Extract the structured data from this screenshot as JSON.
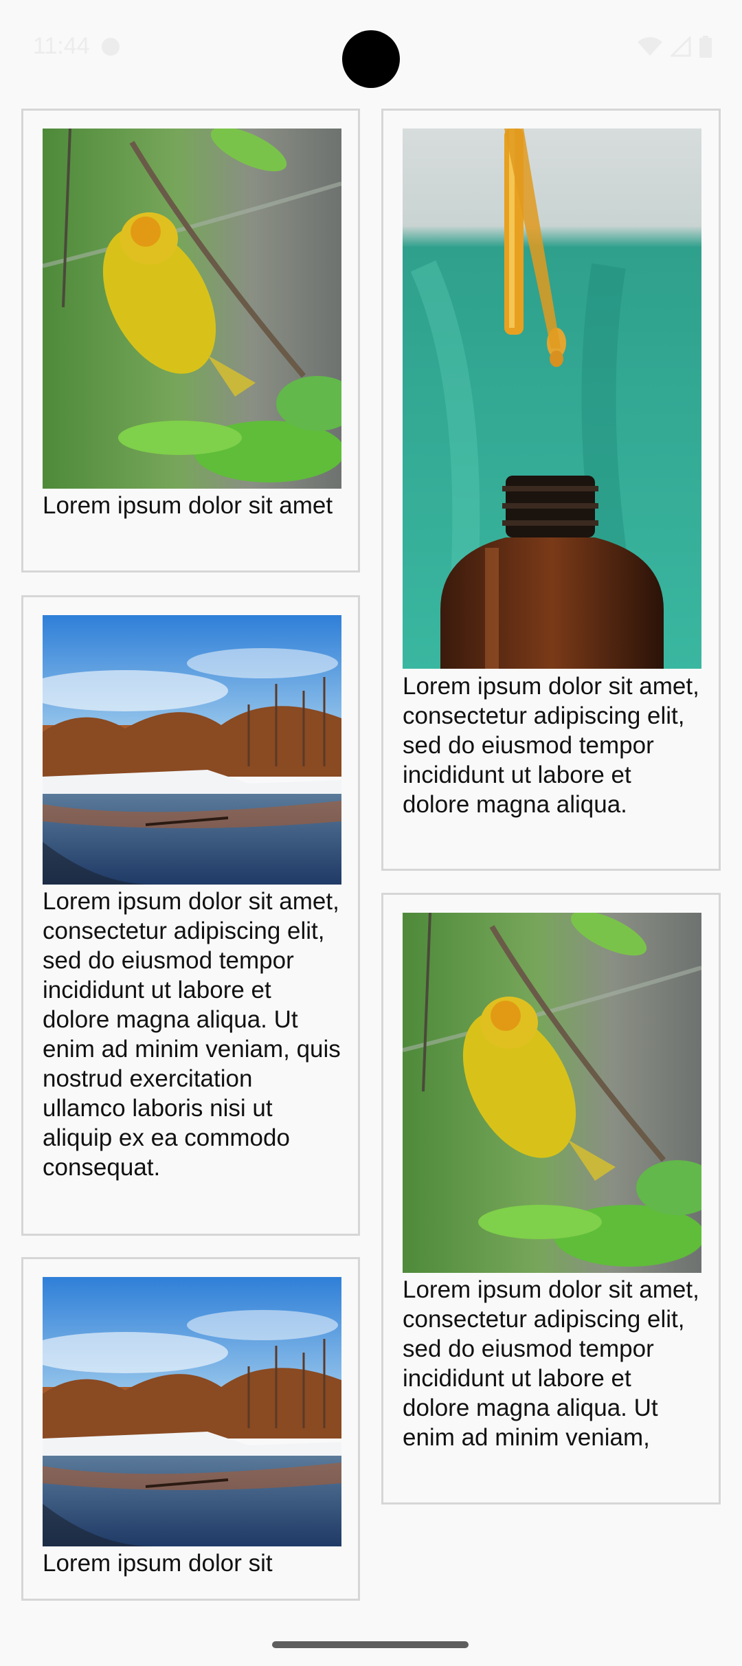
{
  "status_bar": {
    "time": "11:44",
    "icons": [
      "settings-icon",
      "wifi-icon",
      "signal-icon",
      "battery-icon"
    ]
  },
  "cards": [
    {
      "image": "yellow-bird-on-branch",
      "caption": "Lorem ipsum dolor sit amet"
    },
    {
      "image": "oil-dropper-and-bottle",
      "caption": "Lorem ipsum dolor sit amet, consectetur adipiscing elit, sed do eiusmod tempor incididunt ut labore et dolore magna aliqua."
    },
    {
      "image": "winter-river-landscape",
      "caption": "Lorem ipsum dolor sit amet, consectetur adipiscing elit, sed do eiusmod tempor incididunt ut labore et dolore magna aliqua. Ut enim ad minim veniam, quis nostrud exercitation ullamco laboris nisi ut aliquip ex ea commodo consequat."
    },
    {
      "image": "yellow-bird-on-branch",
      "caption": "Lorem ipsum dolor sit amet, consectetur adipiscing elit, sed do eiusmod tempor incididunt ut labore et dolore magna aliqua. Ut enim ad minim veniam,"
    },
    {
      "image": "winter-river-landscape",
      "caption": "Lorem ipsum dolor sit"
    }
  ]
}
